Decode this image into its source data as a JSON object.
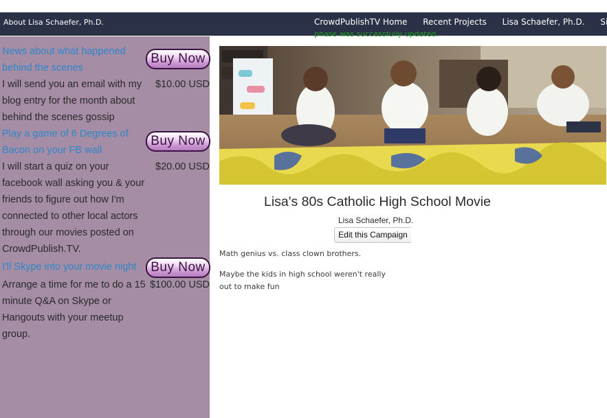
{
  "nav": {
    "brand": "About Lisa Schaefer, Ph.D.",
    "links": [
      "CrowdPublishTV Home",
      "Recent Projects",
      "Lisa Schaefer, Ph.D.",
      "Sign"
    ],
    "flash": "phase was successfully updated."
  },
  "rewards": [
    {
      "title": "News about what happened behind the scenes",
      "button": "Buy Now",
      "price": "$10.00 USD",
      "description": "I will send you an email with my blog entry for the month about behind the scenes gossip"
    },
    {
      "title": "Play a game of 6 Degrees of Bacon on your FB wall",
      "button": "Buy Now",
      "price": "$20.00 USD",
      "description": "I will start a quiz on your facebook wall asking you & your friends to figure out how I'm connected to other local actors through our movies posted on CrowdPublish.TV."
    },
    {
      "title": "I'll Skype into your movie night",
      "button": "Buy Now",
      "price": "$100.00 USD",
      "description": "Arrange a time for me to do a 15 minute Q&A on Skype or Hangouts with your meetup group."
    }
  ],
  "campaign": {
    "title": "Lisa's 80s Catholic High School Movie",
    "author": "Lisa Schaefer, Ph.D.",
    "edit_button": "Edit this Campaign",
    "summary": "Math genius vs. class clown brothers.",
    "story": "Maybe the kids in high school weren't really out to make fun"
  },
  "colors": {
    "nav_bg": "#2b3147",
    "sidebar_bg": "#a58da6",
    "link": "#2e86c9",
    "flash": "#22a122",
    "button_border": "#3a1242"
  }
}
